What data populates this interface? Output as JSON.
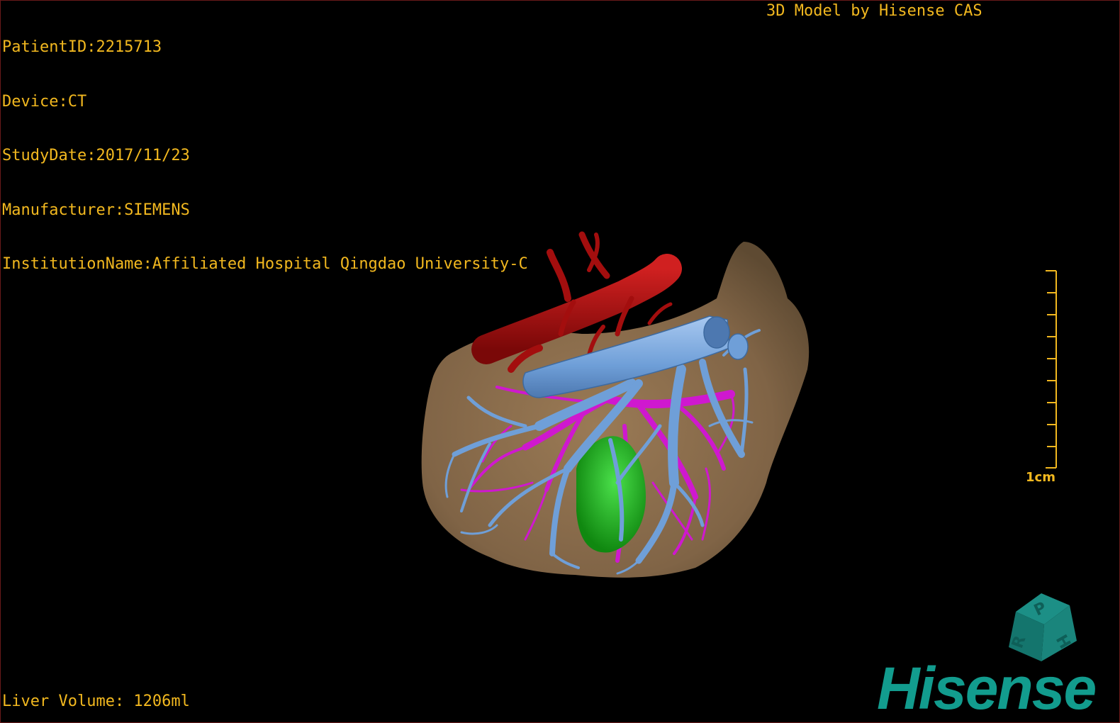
{
  "overlay": {
    "patient_id": "PatientID:2215713",
    "device": "Device:CT",
    "study_date": "StudyDate:2017/11/23",
    "manufacturer": "Manufacturer:SIEMENS",
    "institution": "InstitutionName:Affiliated Hospital Qingdao University-C",
    "model_credit": "3D Model by Hisense CAS",
    "liver_volume": "Liver Volume: 1206ml"
  },
  "scale_bar": {
    "label": "1cm"
  },
  "orientation_cube": {
    "face_letters": [
      "P",
      "H",
      "R"
    ]
  },
  "brand": {
    "logo_text": "Hisense"
  },
  "colors": {
    "overlay_text": "#f2b81f",
    "liver": "#8a6c4a",
    "artery": "#b01010",
    "portal_vein": "#6fa1dc",
    "hepatic_vein": "#d21bd0",
    "gallbladder": "#1fb51f",
    "brand": "#129c8e"
  }
}
